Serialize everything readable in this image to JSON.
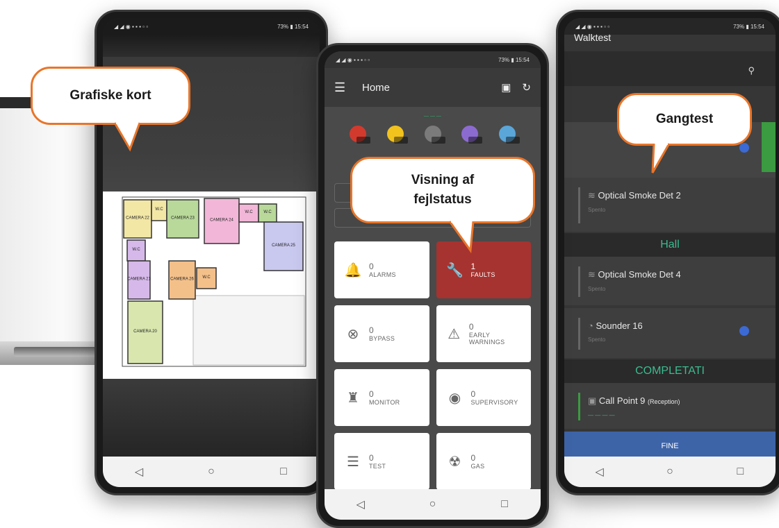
{
  "callouts": {
    "left": "Grafiske kort",
    "center": "Visning af fejlstatus",
    "right": "Gangtest"
  },
  "status_bar": {
    "battery": "73%",
    "time": "15:54"
  },
  "home_screen": {
    "title": "Home",
    "summary_dots": [
      {
        "color": "#d23a2e"
      },
      {
        "color": "#f2c21d"
      },
      {
        "color": "#7b7b7b"
      },
      {
        "color": "#8c6bd1"
      },
      {
        "color": "#5aa6d9"
      }
    ],
    "tiles": [
      {
        "count": "0",
        "label": "ALARMS",
        "icon": "bell-icon",
        "glyph": "🔔",
        "highlight": false
      },
      {
        "count": "1",
        "label": "FAULTS",
        "icon": "wrench-icon",
        "glyph": "🔧",
        "highlight": true
      },
      {
        "count": "0",
        "label": "BYPASS",
        "icon": "bypass-icon",
        "glyph": "⊗",
        "highlight": false
      },
      {
        "count": "0",
        "label": "EARLY WARNINGS",
        "icon": "warning-icon",
        "glyph": "⚠",
        "highlight": false
      },
      {
        "count": "0",
        "label": "MONITOR",
        "icon": "monitor-icon",
        "glyph": "♜",
        "highlight": false
      },
      {
        "count": "0",
        "label": "SUPERVISORY",
        "icon": "supervisory-icon",
        "glyph": "◉",
        "highlight": false
      },
      {
        "count": "0",
        "label": "TEST",
        "icon": "test-icon",
        "glyph": "☰",
        "highlight": false
      },
      {
        "count": "0",
        "label": "GAS",
        "icon": "gas-icon",
        "glyph": "☢",
        "highlight": false
      }
    ]
  },
  "walktest_screen": {
    "title": "Walktest",
    "devices_top": [
      {
        "name": "Optical Smoke Det 2"
      }
    ],
    "section_hall": "Hall",
    "devices_hall": [
      {
        "name": "Optical Smoke Det 4"
      },
      {
        "name": "Sounder 16"
      }
    ],
    "section_completed": "COMPLETATI",
    "devices_completed": [
      {
        "name": "Call Point 9",
        "location": "(Reception)"
      }
    ],
    "finish_button": "FINE"
  },
  "floorplan_rooms": [
    {
      "label": "CAMERA 22",
      "color": "#f3e7a6"
    },
    {
      "label": "W.C",
      "color": "#f3e7a6"
    },
    {
      "label": "CAMERA 23",
      "color": "#b9d99a"
    },
    {
      "label": "CAMERA 24",
      "color": "#f2b7d8"
    },
    {
      "label": "W.C",
      "color": "#f2b7d8"
    },
    {
      "label": "W.C",
      "color": "#b9d99a"
    },
    {
      "label": "CAMERA 25",
      "color": "#c9c8ef"
    },
    {
      "label": "W.C",
      "color": "#d6b9ea"
    },
    {
      "label": "CAMERA 21",
      "color": "#d6b9ea"
    },
    {
      "label": "CAMERA 26",
      "color": "#f4c08a"
    },
    {
      "label": "W.C",
      "color": "#f4c08a"
    },
    {
      "label": "CAMERA 20",
      "color": "#d9e6ae"
    }
  ]
}
